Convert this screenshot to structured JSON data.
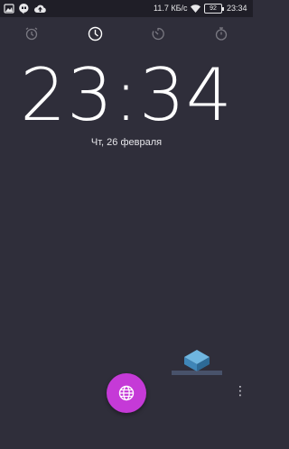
{
  "status_bar": {
    "network_speed": "11.7 КБ/с",
    "battery_level": "92",
    "time": "23:34",
    "notification_icons": [
      "gallery-icon",
      "hangouts-icon",
      "cloud-upload-icon"
    ]
  },
  "tabs": [
    {
      "name": "alarm-tab",
      "icon": "alarm-icon",
      "active": false
    },
    {
      "name": "clock-tab",
      "icon": "clock-icon",
      "active": true
    },
    {
      "name": "timer-tab",
      "icon": "timer-icon",
      "active": false
    },
    {
      "name": "stopwatch-tab",
      "icon": "stopwatch-icon",
      "active": false
    }
  ],
  "clock": {
    "time": "23:34",
    "date": "Чт, 26 февраля"
  },
  "fab": {
    "icon": "globe-icon"
  },
  "overflow": {
    "icon": "more-dots-icon",
    "glyph": "⋮"
  },
  "colors": {
    "background": "#2f2e3a",
    "status_bar": "#1f1e27",
    "fab": "#c53ad7",
    "tab_inactive": "#7a7982",
    "tab_active": "#ffffff"
  }
}
